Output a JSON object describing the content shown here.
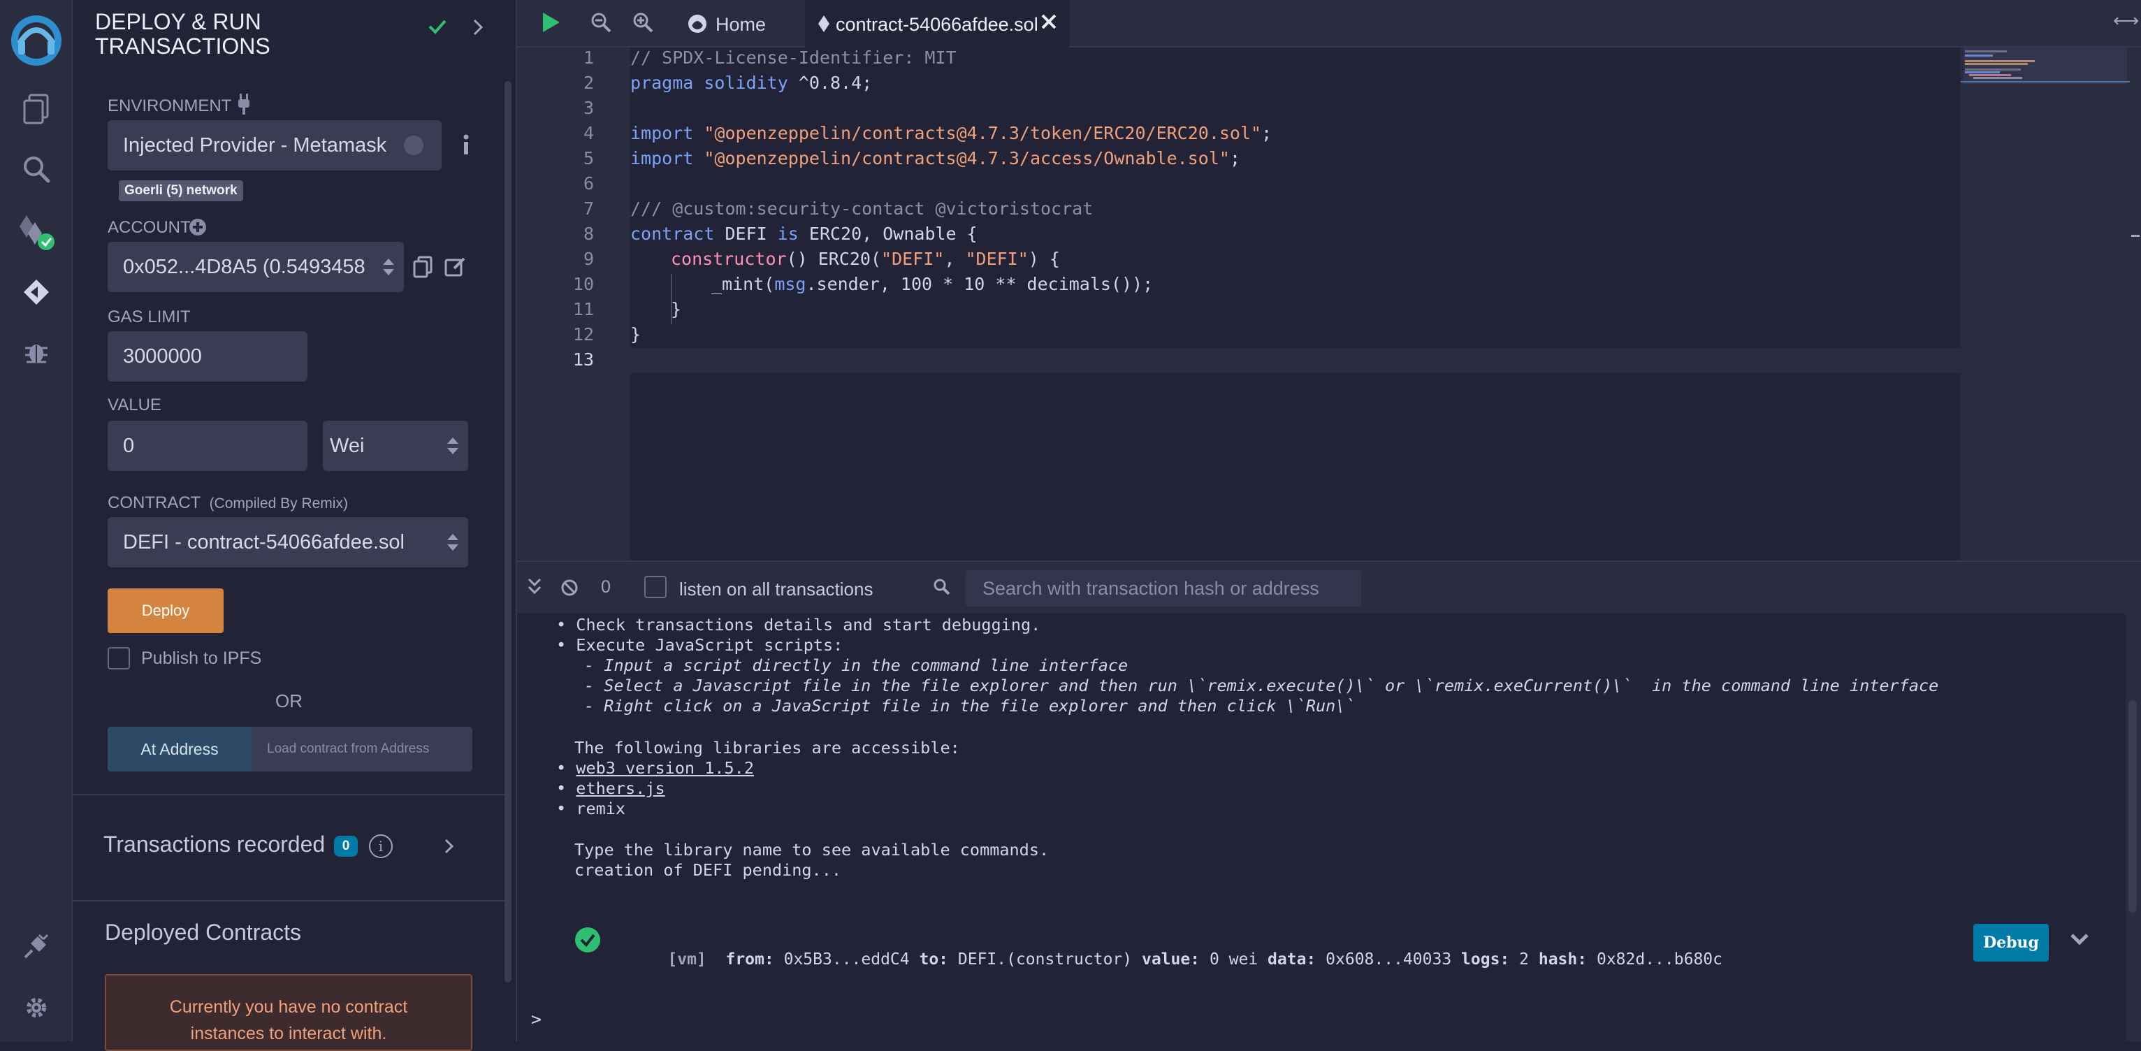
{
  "panel": {
    "title_line1": "DEPLOY & RUN",
    "title_line2": "TRANSACTIONS",
    "environment_label": "ENVIRONMENT",
    "environment_value": "Injected Provider - Metamask",
    "network_badge": "Goerli (5) network",
    "account_label": "ACCOUNT",
    "account_value": "0x052...4D8A5 (0.5493458",
    "gas_limit_label": "GAS LIMIT",
    "gas_limit_value": "3000000",
    "value_label": "VALUE",
    "value_amount": "0",
    "value_unit": "Wei",
    "contract_label": "CONTRACT",
    "contract_sub": "(Compiled By Remix)",
    "contract_value": "DEFI - contract-54066afdee.sol",
    "deploy_button": "Deploy",
    "publish_ipfs": "Publish to IPFS",
    "or": "OR",
    "at_address_button": "At Address",
    "at_address_placeholder": "Load contract from Address",
    "transactions_recorded": "Transactions recorded",
    "transactions_count": "0",
    "deployed_contracts": "Deployed Contracts",
    "no_contract_line1": "Currently you have no contract",
    "no_contract_line2": "instances to interact with."
  },
  "tabs": {
    "home": "Home",
    "file": "contract-54066afdee.sol"
  },
  "editor": {
    "line_numbers": [
      "1",
      "2",
      "3",
      "4",
      "5",
      "6",
      "7",
      "8",
      "9",
      "10",
      "11",
      "12",
      "13"
    ],
    "l1": "// SPDX-License-Identifier: MIT",
    "l2_kw": "pragma solidity",
    "l2_rest": " ^0.8.4;",
    "l4_kw": "import",
    "l4_str": " \"@openzeppelin/contracts@4.7.3/token/ERC20/ERC20.sol\"",
    "l4_end": ";",
    "l5_kw": "import",
    "l5_str": " \"@openzeppelin/contracts@4.7.3/access/Ownable.sol\"",
    "l5_end": ";",
    "l7": "/// @custom:security-contact @victoristocrat",
    "l8_kw1": "contract",
    "l8_mid": " DEFI ",
    "l8_kw2": "is",
    "l8_rest": " ERC20, Ownable {",
    "l9_fn": "constructor",
    "l9_a": "() ERC20(",
    "l9_s1": "\"DEFI\"",
    "l9_b": ", ",
    "l9_s2": "\"DEFI\"",
    "l9_c": ") {",
    "l10_a": "_mint(",
    "l10_kw": "msg",
    "l10_b": ".sender, 100 * 10 ** decimals());",
    "l11": "}",
    "l12": "}"
  },
  "terminal": {
    "count": "0",
    "listen_label": "listen on all transactions",
    "search_placeholder": "Search with transaction hash or address",
    "lines": {
      "t1": "Check transactions details and start debugging.",
      "t2": "Execute JavaScript scripts:",
      "t3": "- Input a script directly in the command line interface",
      "t4": "- Select a Javascript file in the file explorer and then run \\`remix.execute()\\` or \\`remix.exeCurrent()\\`  in the command line interface",
      "t5": "- Right click on a JavaScript file in the file explorer and then click \\`Run\\`",
      "t6": "The following libraries are accessible:",
      "t7": "web3 version 1.5.2",
      "t8": "ethers.js",
      "t9": "remix",
      "t10": "Type the library name to see available commands.",
      "t11": "creation of DEFI pending..."
    },
    "tx": {
      "tag": "[vm]",
      "from_label": "from:",
      "from": "0x5B3...eddC4",
      "to_label": "to:",
      "to": "DEFI.(constructor)",
      "value_label": "value:",
      "value": "0 wei",
      "data_label": "data:",
      "data": "0x608...40033",
      "logs_label": "logs:",
      "logs": "2",
      "hash_label": "hash:",
      "hash": "0x82d...b680c",
      "debug_button": "Debug"
    },
    "prompt": ">"
  },
  "colors": {
    "accent_blue": "#007aa6",
    "deploy_orange": "#d4843e",
    "success_green": "#2fbf71"
  }
}
